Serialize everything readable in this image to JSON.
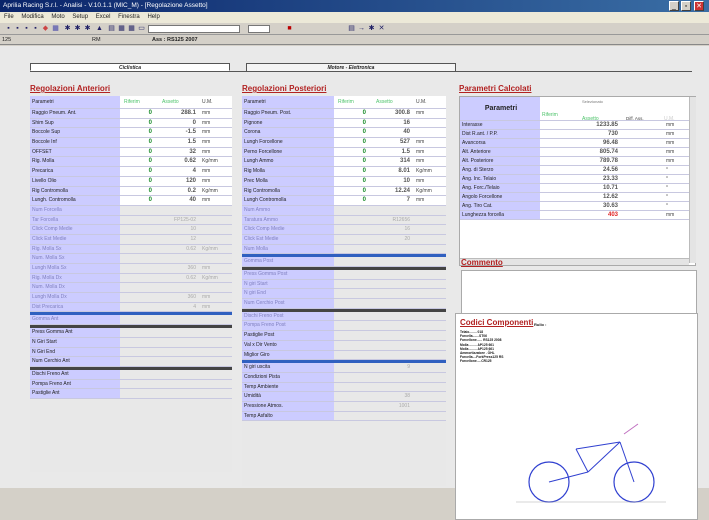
{
  "window": {
    "title": "Aprilia Racing S.r.l. - Analisi - V.10.1.1 (MIC_M) - [Regolazione Assetto]",
    "minimize": "_",
    "maximize": "▫",
    "close": "✕"
  },
  "menu": [
    "File",
    "Modifica",
    "Moto",
    "Setup",
    "Excel",
    "Finestra",
    "Help"
  ],
  "info": {
    "left": "125",
    "mid": "RM",
    "assetto": "Ass : RS125 2007"
  },
  "tabs": {
    "ciclistica": "Ciclistica",
    "motore": "Motore - Elettronica"
  },
  "anteriori": {
    "title": "Regolazioni Anteriori",
    "headers": {
      "param": "Parametri",
      "rif": "Riferim",
      "ass": "Assetto",
      "um": "U.M."
    },
    "rows": [
      {
        "p": "Raggio Pneum. Ant.",
        "r": "0",
        "a": "288.1",
        "u": "mm"
      },
      {
        "p": "Shim Sup",
        "r": "0",
        "a": "0",
        "u": "mm"
      },
      {
        "p": "Boccole Sup",
        "r": "0",
        "a": "-1.5",
        "u": "mm"
      },
      {
        "p": "Boccole Inf",
        "r": "0",
        "a": "1.5",
        "u": "mm"
      },
      {
        "p": "OFFSET",
        "r": "0",
        "a": "32",
        "u": "mm"
      },
      {
        "p": "Rig. Molla",
        "r": "0",
        "a": "0.62",
        "u": "Kg/mm"
      },
      {
        "p": "Precarica",
        "r": "0",
        "a": "4",
        "u": "mm"
      },
      {
        "p": "Livello Olio",
        "r": "0",
        "a": "120",
        "u": "mm"
      },
      {
        "p": "Rig Contromolla",
        "r": "0",
        "a": "0.2",
        "u": "Kg/mm"
      },
      {
        "p": "Lungh. Contromolla",
        "r": "0",
        "a": "40",
        "u": "mm"
      },
      {
        "p": "Num Forcella",
        "r": "",
        "a": "",
        "u": ""
      },
      {
        "p": "Tar Forcella",
        "r": "",
        "a": "FP125-02",
        "u": ""
      },
      {
        "p": "Click Comp Medie",
        "r": "",
        "a": "10",
        "u": ""
      },
      {
        "p": "Click Est Medie",
        "r": "",
        "a": "12",
        "u": ""
      },
      {
        "p": "Rig. Molla Sx",
        "r": "",
        "a": "0.62",
        "u": "Kg/mm"
      },
      {
        "p": "Num. Molla Sx",
        "r": "",
        "a": "",
        "u": ""
      },
      {
        "p": "Lungh Molla Sx",
        "r": "",
        "a": "360",
        "u": "mm"
      },
      {
        "p": "Rig. Molla Dx",
        "r": "",
        "a": "0.62",
        "u": "Kg/mm"
      },
      {
        "p": "Num. Molla Dx",
        "r": "",
        "a": "",
        "u": ""
      },
      {
        "p": "Lungh Molla Dx",
        "r": "",
        "a": "360",
        "u": "mm"
      },
      {
        "p": "Dist Precarica",
        "r": "",
        "a": "4",
        "u": "mm"
      },
      {
        "p": "Gomma Ant",
        "r": "",
        "a": "",
        "u": ""
      },
      {
        "p": "Press Gomma Ant",
        "r": "",
        "a": "",
        "u": ""
      },
      {
        "p": "N Giri Start",
        "r": "",
        "a": "",
        "u": ""
      },
      {
        "p": "N Giri End",
        "r": "",
        "a": "",
        "u": ""
      },
      {
        "p": "Num Cerchio Ant",
        "r": "",
        "a": "",
        "u": ""
      },
      {
        "p": "Dischi Freno Ant",
        "r": "",
        "a": "",
        "u": ""
      },
      {
        "p": "Pompa Freno Ant",
        "r": "",
        "a": "",
        "u": ""
      },
      {
        "p": "Pastiglie Ant",
        "r": "",
        "a": "",
        "u": ""
      }
    ]
  },
  "posteriori": {
    "title": "Regolazioni Posteriori",
    "headers": {
      "param": "Parametri",
      "rif": "Riferim",
      "ass": "Assetto",
      "um": "U.M."
    },
    "rows": [
      {
        "p": "Raggio Pneum. Post.",
        "r": "0",
        "a": "300.8",
        "u": "mm"
      },
      {
        "p": "Pignone",
        "r": "0",
        "a": "16",
        "u": ""
      },
      {
        "p": "Corona",
        "r": "0",
        "a": "40",
        "u": ""
      },
      {
        "p": "Lungh Forcellone",
        "r": "0",
        "a": "527",
        "u": "mm"
      },
      {
        "p": "Perno Forcellone",
        "r": "0",
        "a": "1.5",
        "u": "mm"
      },
      {
        "p": "Lungh Ammo",
        "r": "0",
        "a": "314",
        "u": "mm"
      },
      {
        "p": "Rig Molla",
        "r": "0",
        "a": "8.01",
        "u": "Kg/mm"
      },
      {
        "p": "Prec Molla",
        "r": "0",
        "a": "10",
        "u": "mm"
      },
      {
        "p": "Rig Contromolla",
        "r": "0",
        "a": "12.24",
        "u": "Kg/mm"
      },
      {
        "p": "Lungh Contromolla",
        "r": "0",
        "a": "7",
        "u": "mm"
      },
      {
        "p": "Num Ammo",
        "r": "",
        "a": "",
        "u": ""
      },
      {
        "p": "Taratura Ammo",
        "r": "",
        "a": "R12656",
        "u": ""
      },
      {
        "p": "Click Comp Medie",
        "r": "",
        "a": "16",
        "u": ""
      },
      {
        "p": "Click Est Medie",
        "r": "",
        "a": "20",
        "u": ""
      },
      {
        "p": "Num Molla",
        "r": "",
        "a": "",
        "u": ""
      },
      {
        "p": "Gomma Post",
        "r": "",
        "a": "",
        "u": ""
      },
      {
        "p": "Press Gomma Post",
        "r": "",
        "a": "",
        "u": ""
      },
      {
        "p": "N giri Start",
        "r": "",
        "a": "",
        "u": ""
      },
      {
        "p": "N giri End",
        "r": "",
        "a": "",
        "u": ""
      },
      {
        "p": "Num Cerchio Post",
        "r": "",
        "a": "",
        "u": ""
      },
      {
        "p": "Dischi Freno Post",
        "r": "",
        "a": "",
        "u": ""
      },
      {
        "p": "Pompa Freno Post",
        "r": "",
        "a": "",
        "u": ""
      },
      {
        "p": "Pastiglie Post",
        "r": "",
        "a": "",
        "u": ""
      },
      {
        "p": "Val x Dir Vento",
        "r": "",
        "a": "",
        "u": ""
      },
      {
        "p": "Miglior Giro",
        "r": "",
        "a": "",
        "u": ""
      },
      {
        "p": "N giri uscita",
        "r": "",
        "a": "9",
        "u": ""
      },
      {
        "p": "Condizioni Pista",
        "r": "",
        "a": "",
        "u": ""
      },
      {
        "p": "Temp Ambiente",
        "r": "",
        "a": "",
        "u": ""
      },
      {
        "p": "Umidità",
        "r": "",
        "a": "38",
        "u": ""
      },
      {
        "p": "Pressione Atmos.",
        "r": "",
        "a": "1001",
        "u": ""
      },
      {
        "p": "Temp Asfalto",
        "r": "",
        "a": "",
        "u": ""
      }
    ]
  },
  "calcolati": {
    "title": "Parametri Calcolati",
    "headers": {
      "param": "Parametri",
      "rif": "Riferim",
      "sel": "Selezionato",
      "ass": "Assetto",
      "diff": "Diff. Ass.",
      "um": "U.M."
    },
    "rows": [
      {
        "p": "Interasse",
        "a": "1233.85",
        "u": "mm"
      },
      {
        "p": "Dist R.ant. / P.P.",
        "a": "730",
        "u": "mm"
      },
      {
        "p": "Avancorsa",
        "a": "96.48",
        "u": "mm"
      },
      {
        "p": "Alt. Anteriore",
        "a": "805.74",
        "u": "mm"
      },
      {
        "p": "Alt. Posteriore",
        "a": "789.78",
        "u": "mm"
      },
      {
        "p": "Ang. di Sterzo",
        "a": "24.56",
        "u": "°"
      },
      {
        "p": "Ang. Inc. Telaio",
        "a": "23.33",
        "u": "°"
      },
      {
        "p": "Ang. Forc./Telaio",
        "a": "10.71",
        "u": "°"
      },
      {
        "p": "Angolo Forcellone",
        "a": "12.62",
        "u": "°"
      },
      {
        "p": "Ang. Tiro Cat.",
        "a": "30.63",
        "u": "°"
      },
      {
        "p": "Lunghezza forcella",
        "a": "403",
        "u": "mm"
      }
    ]
  },
  "commento": {
    "title": "Commento"
  },
  "codici": {
    "title": "Codici Componenti",
    "rulo": "Rullo :",
    "lines": [
      "Telaio........ 018",
      "Forcella.......ST06",
      "Forcellone...... RS125 2008",
      "Molla ........ AP125 661",
      "Molla ........ AP125 661",
      "Ammortizzatore . ÖHL",
      "Forcella....ForkPress125 RS",
      "Forcellone.....CR125"
    ]
  }
}
